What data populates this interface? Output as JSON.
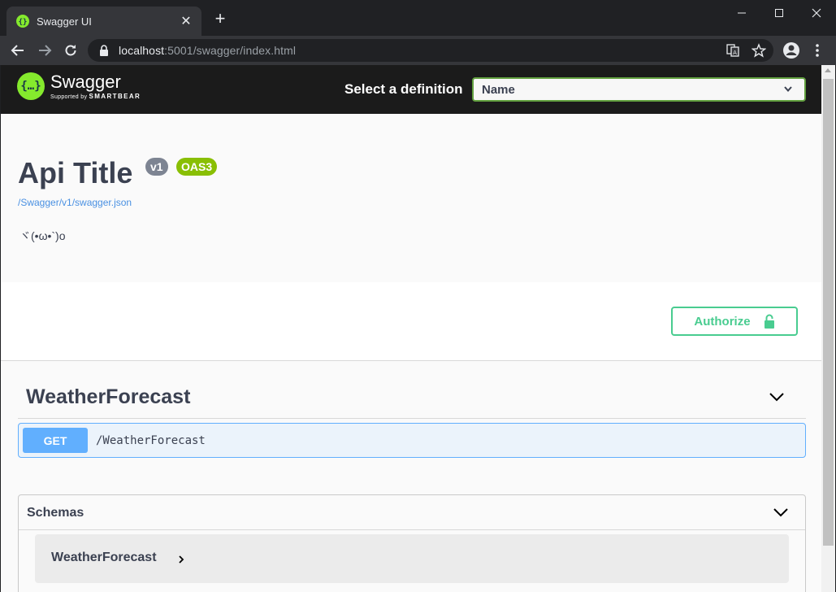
{
  "browser": {
    "tab_title": "Swagger UI",
    "url_host": "localhost",
    "url_rest": ":5001/swagger/index.html"
  },
  "topbar": {
    "logo_name": "Swagger",
    "logo_sub_prefix": "Supported by ",
    "logo_sub_brand": "SMARTBEAR",
    "definition_label": "Select a definition",
    "definition_selected": "Name"
  },
  "info": {
    "title": "Api Title",
    "version_badge": "v1",
    "oas_badge": "OAS3",
    "spec_link": "/Swagger/v1/swagger.json",
    "description": "ヾ(•ω•`)o"
  },
  "auth": {
    "button_label": "Authorize"
  },
  "tag": {
    "name": "WeatherForecast",
    "operations": [
      {
        "method": "GET",
        "path": "/WeatherForecast"
      }
    ]
  },
  "schemas": {
    "title": "Schemas",
    "models": [
      {
        "name": "WeatherForecast"
      }
    ]
  },
  "colors": {
    "topbar_bg": "#1b1b1b",
    "swagger_green": "#85ea2d",
    "select_border": "#62a03f",
    "authorize": "#49cc90",
    "get_blue": "#61affe",
    "version_badge": "#7d8492",
    "oas_badge": "#89bf04",
    "text_dark": "#3b4151",
    "link": "#4990e2"
  }
}
